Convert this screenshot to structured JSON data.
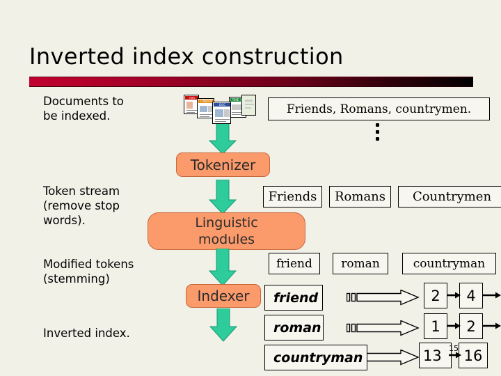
{
  "slide": {
    "title": "Inverted index construction",
    "accent_start": "#c2002f",
    "accent_end": "#000000",
    "background": "#f2f1e8",
    "process_fill": "#fb9a6b",
    "arrow_fill": "#2ecc9b"
  },
  "captions": {
    "documents": "Documents to\nbe indexed.",
    "token_stream": "Token stream\n(remove stop\n words).",
    "modified_tokens": "Modified tokens\n(stemming)",
    "inverted_index": "Inverted index."
  },
  "sentence": {
    "text": "Friends, Romans, countrymen.",
    "ellipsis": "⋮"
  },
  "documents": [
    {
      "band": "mm",
      "band_color": "#cc1111"
    },
    {
      "band": "LONDON",
      "band_color": "#e08a10"
    },
    {
      "band": "DOC",
      "band_color": "#2b4f9e"
    },
    {
      "band": "TIME",
      "band_color": "#1b8a3a"
    },
    {
      "band": "",
      "band_color": "#8fae6d"
    }
  ],
  "processes": {
    "tokenizer": "Tokenizer",
    "linguistic_line1": "Linguistic",
    "linguistic_line2": "modules",
    "indexer": "Indexer"
  },
  "tokens": [
    "Friends",
    "Romans",
    "Countrymen"
  ],
  "stemmed": [
    "friend",
    "roman",
    "countryman"
  ],
  "index": {
    "terms": [
      "friend",
      "roman",
      "countryman"
    ],
    "postings": [
      {
        "term": "friend",
        "docs": [
          "2",
          "4"
        ],
        "continues": true
      },
      {
        "term": "roman",
        "docs": [
          "1",
          "2"
        ],
        "continues": true
      },
      {
        "term": "countryman",
        "docs": [
          "13",
          "16"
        ],
        "superscript": "15",
        "continues": false
      }
    ]
  }
}
